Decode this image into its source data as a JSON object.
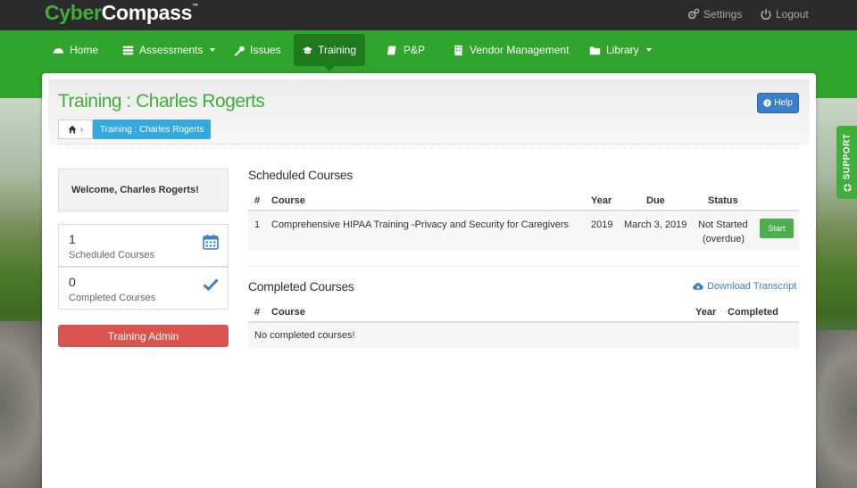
{
  "brand": {
    "part1": "Cyber",
    "part2": "Compass",
    "tm": "™"
  },
  "topbar": {
    "settings_label": "Settings",
    "logout_label": "Logout"
  },
  "nav": {
    "items": [
      {
        "label": "Home",
        "icon": "dashboard-icon"
      },
      {
        "label": "Assessments",
        "icon": "list-icon",
        "dropdown": true
      },
      {
        "label": "Issues",
        "icon": "wrench-icon"
      },
      {
        "label": "Training",
        "icon": "graduation-cap-icon",
        "active": true
      },
      {
        "label": "P&P",
        "icon": "book-icon"
      },
      {
        "label": "Vendor Management",
        "icon": "building-icon"
      },
      {
        "label": "Library",
        "icon": "folder-icon",
        "dropdown": true
      }
    ]
  },
  "page": {
    "title": "Training : Charles Rogerts",
    "breadcrumb_current": "Training : Charles Rogerts",
    "help_label": "Help"
  },
  "sidebar": {
    "welcome": "Welcome, Charles Rogerts!",
    "scheduled_count": "1",
    "scheduled_label": "Scheduled Courses",
    "completed_count": "0",
    "completed_label": "Completed Courses",
    "admin_button": "Training Admin"
  },
  "scheduled": {
    "title": "Scheduled Courses",
    "headers": {
      "num": "#",
      "course": "Course",
      "year": "Year",
      "due": "Due",
      "status": "Status"
    },
    "rows": [
      {
        "num": "1",
        "course": "Comprehensive HIPAA Training -Privacy and Security for Caregivers",
        "year": "2019",
        "due": "March 3, 2019",
        "status_line1": "Not Started",
        "status_line2": "(overdue)",
        "action": "Start"
      }
    ]
  },
  "completed": {
    "title": "Completed Courses",
    "download_label": "Download Transcript",
    "headers": {
      "num": "#",
      "course": "Course",
      "year": "Year",
      "completed": "Completed"
    },
    "empty_message": "No completed courses!"
  },
  "support": {
    "label": "SUPPORT"
  },
  "colors": {
    "brand_green": "#3fae3a",
    "nav_green": "#2fa52c",
    "nav_active": "#1e7a1c",
    "topbar": "#2b2b2b",
    "help_blue": "#3a7fc7",
    "breadcrumb_blue": "#34a9dd",
    "admin_red": "#d9534f",
    "start_green": "#4cae4c"
  }
}
